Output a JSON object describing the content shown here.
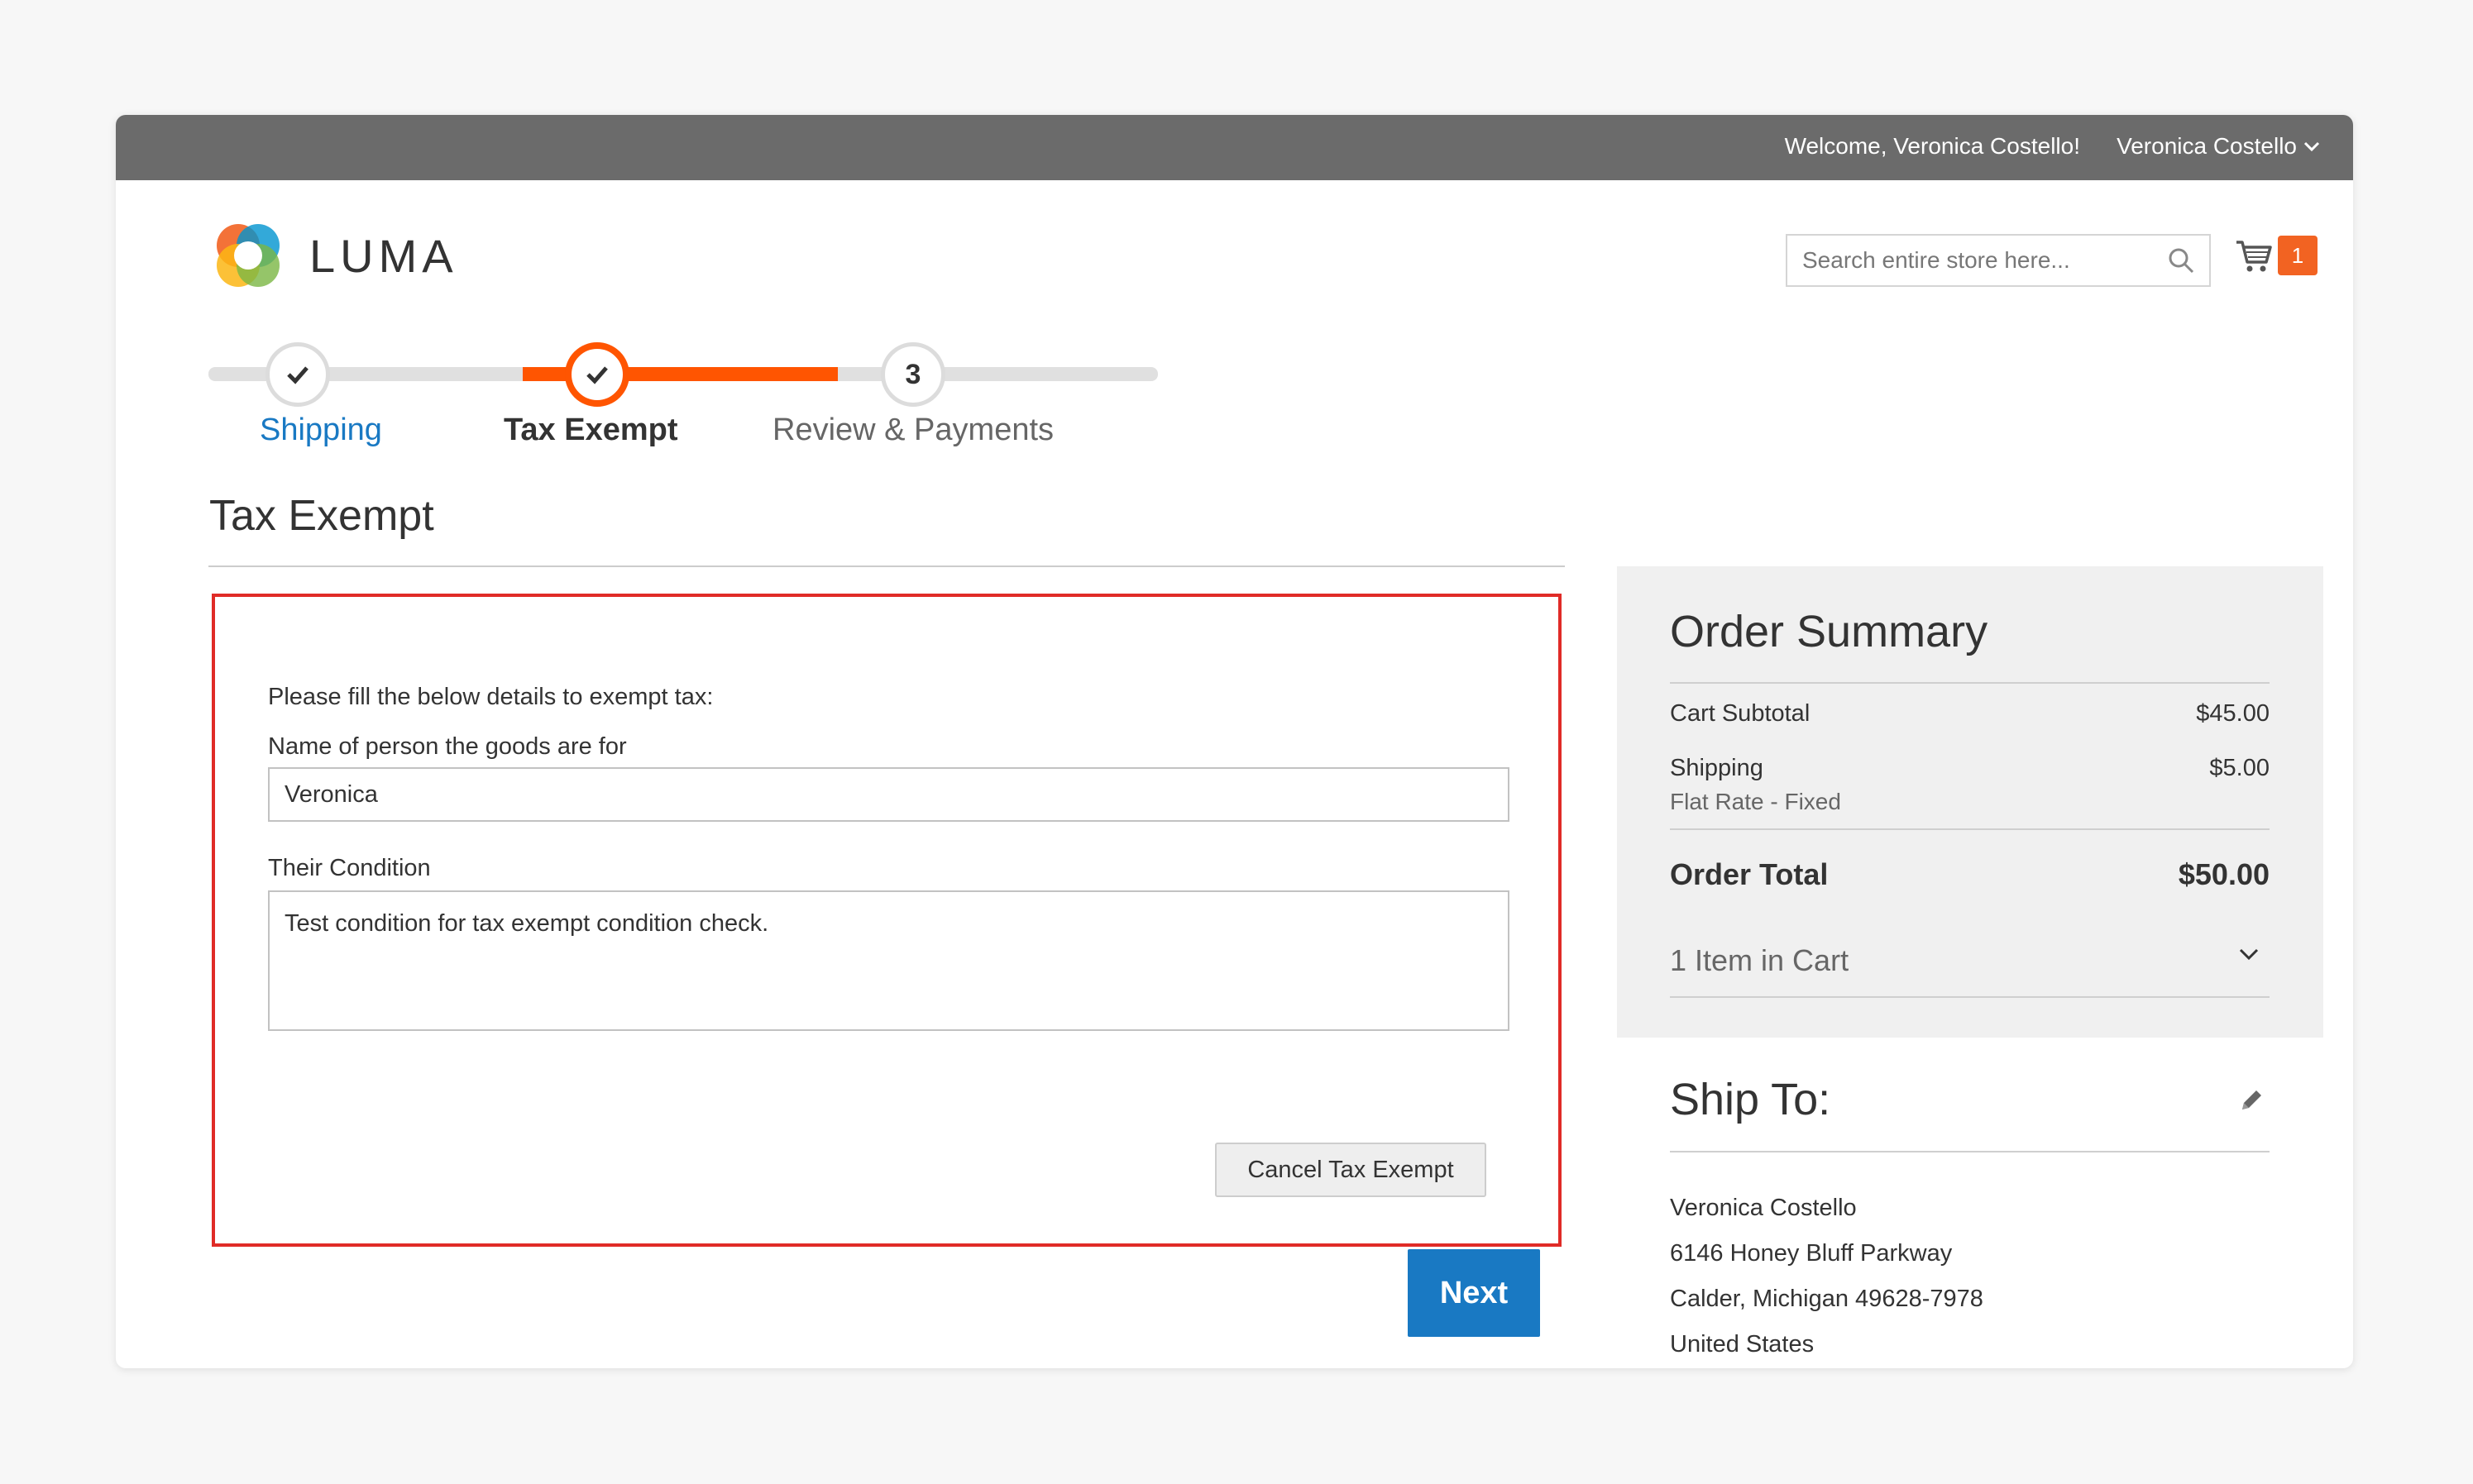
{
  "header": {
    "welcome": "Welcome, Veronica Costello!",
    "account": "Veronica Costello"
  },
  "brand": {
    "name": "LUMA"
  },
  "search": {
    "placeholder": "Search entire store here...",
    "value": ""
  },
  "cart": {
    "count": "1"
  },
  "progress": {
    "steps": [
      {
        "label": "Shipping",
        "state": "complete",
        "marker": "check-icon"
      },
      {
        "label": "Tax Exempt",
        "state": "active",
        "marker": "check-icon"
      },
      {
        "label": "Review & Payments",
        "state": "pending",
        "number": "3"
      }
    ]
  },
  "main": {
    "title": "Tax Exempt",
    "intro": "Please fill the below details to exempt tax:",
    "name_label": "Name of person the goods are for",
    "name_value": "Veronica",
    "condition_label": "Their Condition",
    "condition_value": "Test condition for tax exempt condition check.",
    "cancel_label": "Cancel Tax Exempt",
    "next_label": "Next"
  },
  "summary": {
    "title": "Order Summary",
    "subtotal_label": "Cart Subtotal",
    "subtotal_value": "$45.00",
    "shipping_label": "Shipping",
    "shipping_method": "Flat Rate - Fixed",
    "shipping_value": "$5.00",
    "total_label": "Order Total",
    "total_value": "$50.00",
    "items_label": "1 Item in Cart"
  },
  "ship_to": {
    "title": "Ship To:",
    "name": "Veronica Costello",
    "street": "6146 Honey Bluff Parkway",
    "city": "Calder, Michigan 49628-7978",
    "country": "United States"
  },
  "colors": {
    "topbar": "#6b6b6b",
    "accent": "#ff5501",
    "link": "#1979c3",
    "highlight_border": "#e02b27",
    "cart_badge": "#f26322"
  }
}
